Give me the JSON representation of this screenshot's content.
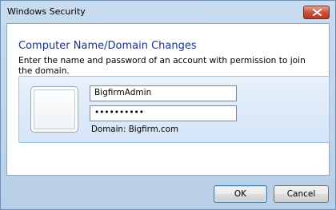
{
  "window": {
    "title": "Windows Security"
  },
  "dialog": {
    "heading": "Computer Name/Domain Changes",
    "description": "Enter the name and password of an account with permission to join the domain."
  },
  "credentials": {
    "username_value": "BigfirmAdmin",
    "password_value": "••••••••••",
    "domain_label": "Domain: Bigfirm.com"
  },
  "buttons": {
    "ok_label": "OK",
    "cancel_label": "Cancel"
  },
  "icons": {
    "close": "close-icon",
    "user_picture": "user-picture-frame"
  },
  "colors": {
    "heading": "#1e3287",
    "close_button": "#c8523d",
    "tile_background": "#d4e4f7"
  }
}
